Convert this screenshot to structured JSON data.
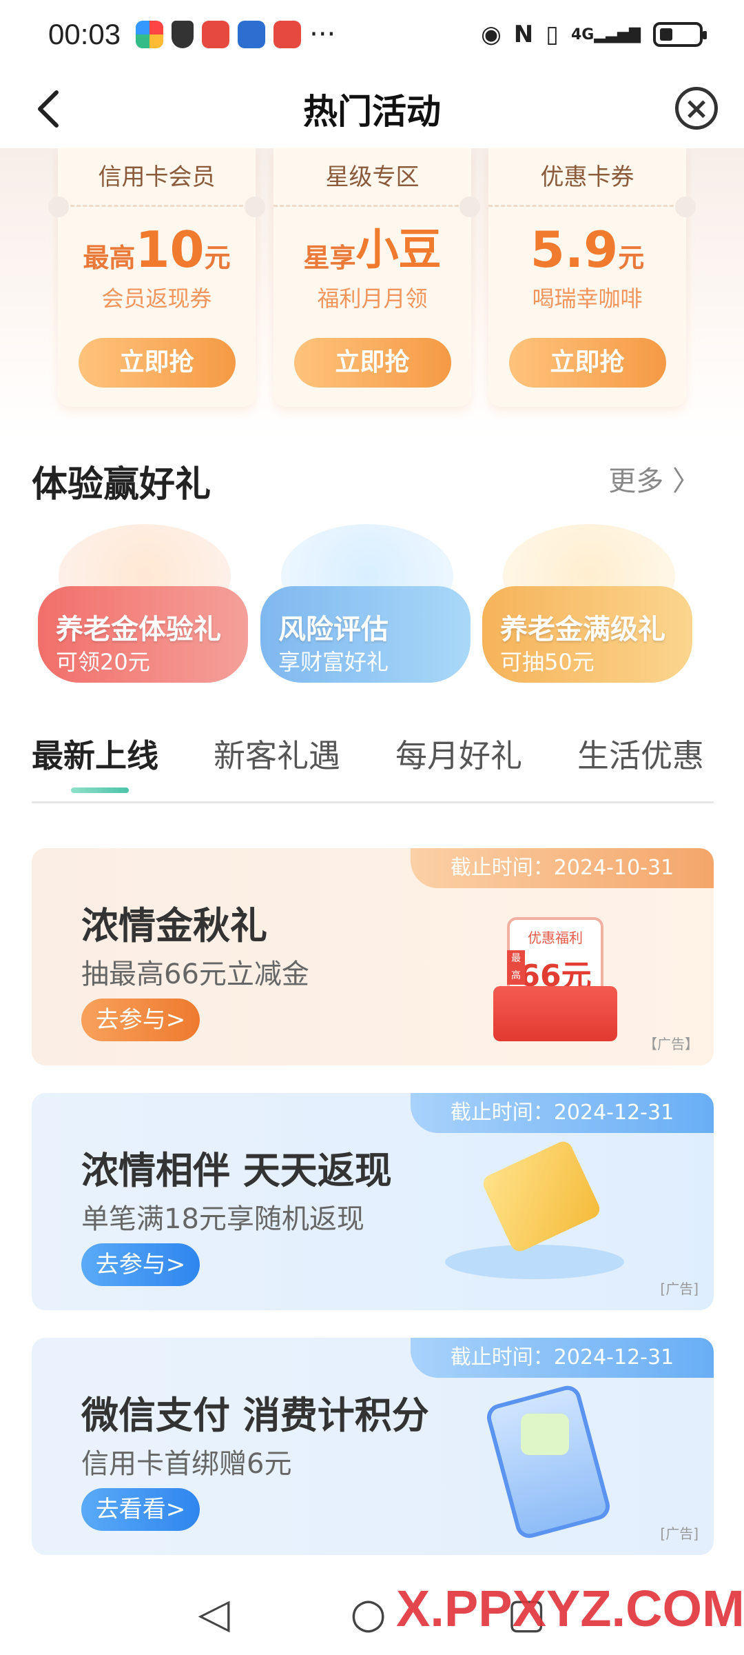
{
  "status_bar": {
    "time": "00:03",
    "icons": [
      "color-wheel-icon",
      "shield-icon",
      "app-icon-red",
      "app-icon-mascot",
      "app-icon-red"
    ],
    "more": "···",
    "right_icons": [
      "eye-icon",
      "nfc-icon",
      "vibrate-icon",
      "signal-4g-icon",
      "battery-icon"
    ],
    "network": "4G"
  },
  "navbar": {
    "title": "热门活动",
    "back_icon": "chevron-left-icon",
    "close_icon": "close-circle-icon"
  },
  "coupons": [
    {
      "header": "信用卡会员",
      "prefix": "最高",
      "big": "10",
      "suffix": "元",
      "subtitle": "会员返现券",
      "button": "立即抢"
    },
    {
      "header": "星级专区",
      "prefix": "星享",
      "big": "小豆",
      "suffix": "",
      "subtitle": "福利月月领",
      "button": "立即抢"
    },
    {
      "header": "优惠卡券",
      "prefix": "",
      "big": "5.9",
      "suffix": "元",
      "subtitle": "喝瑞幸咖啡",
      "button": "立即抢"
    }
  ],
  "experience": {
    "title": "体验赢好礼",
    "more": "更多",
    "items": [
      {
        "title": "养老金体验礼",
        "subtitle": "可领20元",
        "color": "#f07a6e"
      },
      {
        "title": "风险评估",
        "subtitle": "享财富好礼",
        "color": "#7fbef0"
      },
      {
        "title": "养老金满级礼",
        "subtitle": "可抽50元",
        "color": "#f5b55b"
      }
    ]
  },
  "tabs": {
    "items": [
      "最新上线",
      "新客礼遇",
      "每月好礼",
      "生活优惠"
    ],
    "active_index": 0
  },
  "cards": [
    {
      "date": "截止时间：2024-10-31",
      "title": "浓情金秋礼",
      "subtitle": "抽最高66元立减金",
      "button": "去参与>",
      "ad": "【广告】",
      "theme": "orange",
      "art_label": "优惠福利",
      "art_value": "66元",
      "art_prefix": "最高"
    },
    {
      "date": "截止时间：2024-12-31",
      "title": "浓情相伴 天天返现",
      "subtitle": "单笔满18元享随机返现",
      "button": "去参与>",
      "ad": "[广告]",
      "theme": "blue"
    },
    {
      "date": "截止时间：2024-12-31",
      "title": "微信支付 消费计积分",
      "subtitle": "信用卡首绑赠6元",
      "button": "去看看>",
      "ad": "[广告]",
      "theme": "blue"
    }
  ],
  "bottom_nav": [
    "back-triangle-icon",
    "home-circle-icon",
    "recents-square-icon"
  ],
  "watermark": "X.PPXYZ.COM"
}
